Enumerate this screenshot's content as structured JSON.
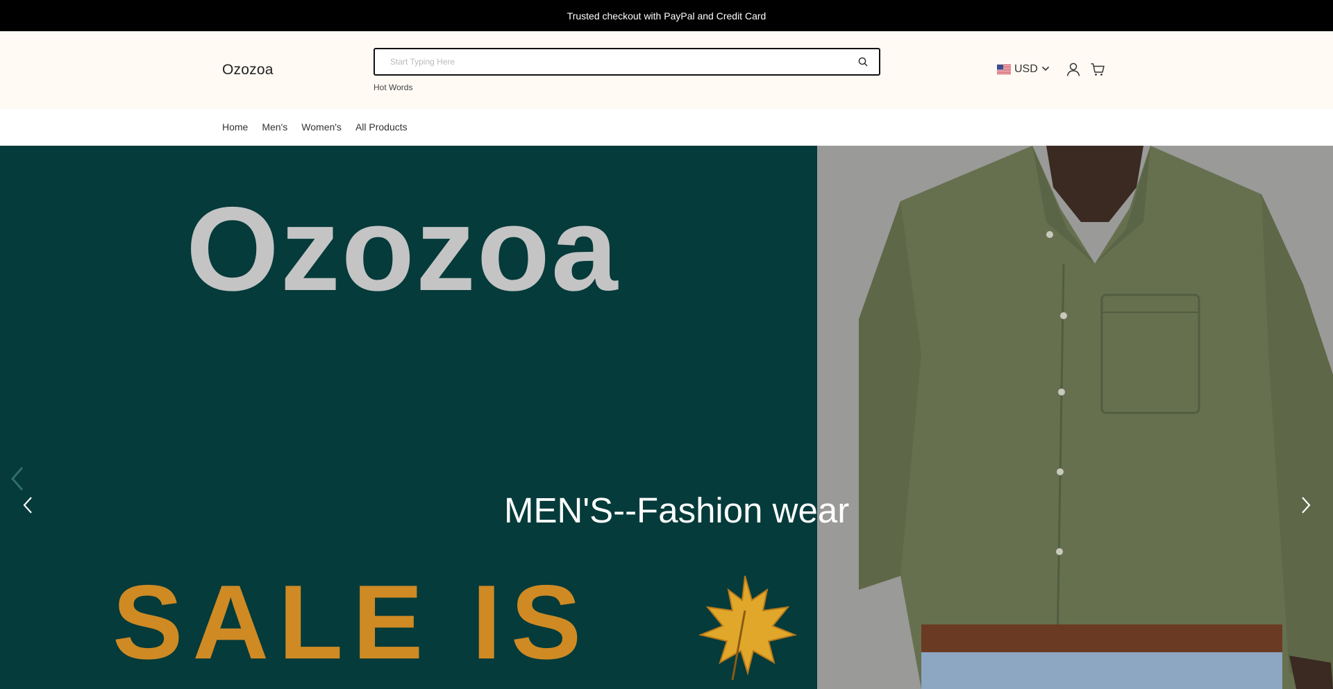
{
  "announcement": {
    "text": "Trusted checkout with PayPal and Credit Card"
  },
  "header": {
    "logo": "Ozozoa",
    "search": {
      "placeholder": "Start Typing Here",
      "value": ""
    },
    "hot_words_label": "Hot Words",
    "currency": {
      "code": "USD",
      "flag_icon": "us-flag-icon"
    },
    "icons": [
      "search-icon",
      "chevron-down-icon",
      "account-icon",
      "cart-icon"
    ]
  },
  "nav": {
    "items": [
      {
        "label": "Home"
      },
      {
        "label": "Men's"
      },
      {
        "label": "Women's"
      },
      {
        "label": "All Products"
      }
    ]
  },
  "hero": {
    "brand_text": "Ozozoa",
    "sale_text": "SALE IS",
    "caption": "MEN'S--Fashion wear",
    "prev_icon": "chevron-left-icon",
    "next_icon": "chevron-right-icon"
  },
  "colors": {
    "announcement_bg": "#000000",
    "header_bg": "#fffaf4",
    "hero_left_bg": "#053b3a",
    "hero_right_bg": "#9a9a98",
    "brand_text": "#c4c4c4",
    "sale_text": "#cf8a24",
    "shirt": "#66704f"
  }
}
